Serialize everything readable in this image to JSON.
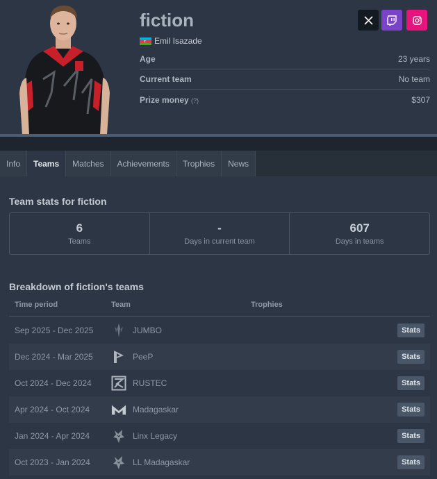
{
  "player": {
    "nickname": "fiction",
    "real_name": "Emil Isazade",
    "flag": "azerbaijan-flag",
    "age_label": "Age",
    "age_value": "23 years",
    "team_label": "Current team",
    "team_value": "No team",
    "prize_label": "Prize money",
    "prize_help": "(?)",
    "prize_value": "$307"
  },
  "social": [
    {
      "name": "x-icon",
      "color": "#141a21"
    },
    {
      "name": "twitch-icon",
      "color": "#7b44c8"
    },
    {
      "name": "instagram-icon",
      "color": "#e6147c"
    }
  ],
  "tabs": [
    "Info",
    "Teams",
    "Matches",
    "Achievements",
    "Trophies",
    "News"
  ],
  "active_tab": "Teams",
  "team_stats": {
    "title": "Team stats for fiction",
    "items": [
      {
        "value": "6",
        "label": "Teams"
      },
      {
        "value": "-",
        "label": "Days in current team"
      },
      {
        "value": "607",
        "label": "Days in teams"
      }
    ]
  },
  "breakdown": {
    "title": "Breakdown of fiction's teams",
    "columns": [
      "Time period",
      "Team",
      "Trophies"
    ],
    "button_label": "Stats",
    "rows": [
      {
        "period": "Sep 2025 - Dec 2025",
        "team": "JUMBO",
        "logo": "jumbo-logo"
      },
      {
        "period": "Dec 2024 - Mar 2025",
        "team": "PeeP",
        "logo": "peep-logo"
      },
      {
        "period": "Oct 2024 - Dec 2024",
        "team": "RUSTEC",
        "logo": "rustec-logo"
      },
      {
        "period": "Apr 2024 - Oct 2024",
        "team": "Madagaskar",
        "logo": "madagaskar-logo"
      },
      {
        "period": "Jan 2024 - Apr 2024",
        "team": "Linx Legacy",
        "logo": "linx-legacy-logo"
      },
      {
        "period": "Oct 2023 - Jan 2024",
        "team": "LL Madagaskar",
        "logo": "ll-madagaskar-logo"
      }
    ]
  },
  "colors": {
    "background": "#2d3644",
    "accent_red": "#d4202a",
    "stats_button": "#4a5768"
  }
}
